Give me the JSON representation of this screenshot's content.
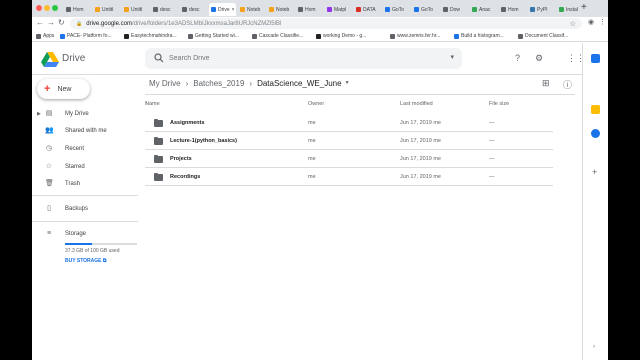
{
  "browser": {
    "tabs": [
      {
        "label": "Hom",
        "color": "#5f6368"
      },
      {
        "label": "Untitl",
        "color": "#f4a21a"
      },
      {
        "label": "Untitl",
        "color": "#f4a21a"
      },
      {
        "label": "desc",
        "color": "#5f6368"
      },
      {
        "label": "desc",
        "color": "#5f6368"
      },
      {
        "label": "Drive",
        "color": "#1a73e8",
        "active": true
      },
      {
        "label": "Noteb",
        "color": "#f4a21a"
      },
      {
        "label": "Noteb",
        "color": "#f4a21a"
      },
      {
        "label": "Hom",
        "color": "#5f6368"
      },
      {
        "label": "Matpl",
        "color": "#9334e6"
      },
      {
        "label": "DATA",
        "color": "#d93025"
      },
      {
        "label": "GoTo",
        "color": "#1a73e8"
      },
      {
        "label": "GoTo",
        "color": "#1a73e8"
      },
      {
        "label": "Dow",
        "color": "#5f6368"
      },
      {
        "label": "Anac",
        "color": "#34a853"
      },
      {
        "label": "Hom",
        "color": "#5f6368"
      },
      {
        "label": "PyPI",
        "color": "#3776ab"
      },
      {
        "label": "Instal",
        "color": "#34a853"
      }
    ],
    "url_host": "drive.google.com",
    "url_path": "/drive/folders/1e3ADSLMbIJkxxmsaJar8URJcNZMZl5lBl",
    "bookmarks": [
      {
        "label": "Apps",
        "color": "#5f6368"
      },
      {
        "label": "PACE- Platform fo...",
        "color": "#1a73e8"
      },
      {
        "label": "Easytechmahindra...",
        "color": "#202124"
      },
      {
        "label": "Getting Started wi...",
        "color": "#5f6368"
      },
      {
        "label": "Cascade Classifie...",
        "color": "#5f6368"
      },
      {
        "label": "working Demo - g...",
        "color": "#202124"
      },
      {
        "label": "www.zemris.fer.hr...",
        "color": "#5f6368"
      },
      {
        "label": "Build a histogram...",
        "color": "#1a73e8"
      },
      {
        "label": "Document Classif...",
        "color": "#5f6368"
      }
    ]
  },
  "header": {
    "app_name": "Drive",
    "search_placeholder": "Search Drive"
  },
  "sidebar": {
    "new_label": "New",
    "items": [
      {
        "label": "My Drive",
        "icon": "my-drive-icon"
      },
      {
        "label": "Shared with me",
        "icon": "shared-icon"
      },
      {
        "label": "Recent",
        "icon": "recent-icon"
      },
      {
        "label": "Starred",
        "icon": "star-icon"
      },
      {
        "label": "Trash",
        "icon": "trash-icon"
      },
      {
        "label": "Backups",
        "icon": "backup-icon"
      },
      {
        "label": "Storage",
        "icon": "storage-icon"
      }
    ],
    "storage_used_text": "37.3 GB of 100 GB used",
    "storage_fraction": 0.373,
    "buy_storage": "BUY STORAGE"
  },
  "main": {
    "breadcrumb": [
      "My Drive",
      "Batches_2019",
      "DataScience_WE_June"
    ],
    "columns": {
      "name": "Name",
      "owner": "Owner",
      "modified": "Last modified",
      "size": "File size"
    },
    "rows": [
      {
        "name": "Assignments",
        "owner": "me",
        "modified": "Jun 17, 2019 me",
        "size": "—"
      },
      {
        "name": "Lecture-1(python_basics)",
        "owner": "me",
        "modified": "Jun 17, 2019 me",
        "size": "—"
      },
      {
        "name": "Projects",
        "owner": "me",
        "modified": "Jun 17, 2019 me",
        "size": "—"
      },
      {
        "name": "Recordings",
        "owner": "me",
        "modified": "Jun 17, 2019 me",
        "size": "—"
      }
    ]
  },
  "colors": {
    "accent": "#1a73e8",
    "text": "#202124",
    "muted": "#5f6368",
    "divider": "#dadce0"
  }
}
